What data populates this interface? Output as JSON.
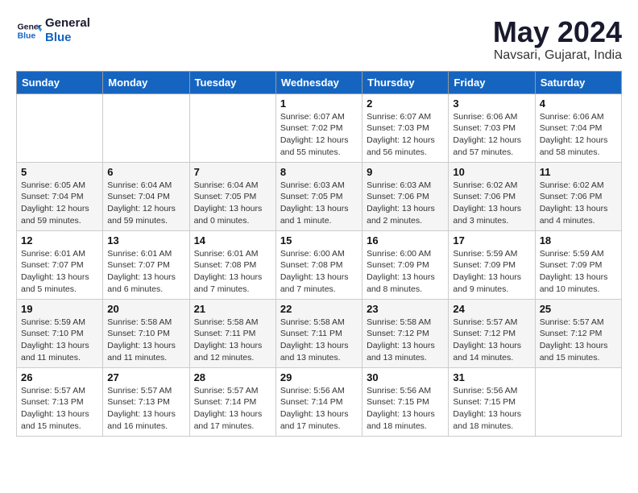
{
  "header": {
    "logo_line1": "General",
    "logo_line2": "Blue",
    "month": "May 2024",
    "location": "Navsari, Gujarat, India"
  },
  "weekdays": [
    "Sunday",
    "Monday",
    "Tuesday",
    "Wednesday",
    "Thursday",
    "Friday",
    "Saturday"
  ],
  "weeks": [
    [
      {
        "day": "",
        "info": ""
      },
      {
        "day": "",
        "info": ""
      },
      {
        "day": "",
        "info": ""
      },
      {
        "day": "1",
        "info": "Sunrise: 6:07 AM\nSunset: 7:02 PM\nDaylight: 12 hours\nand 55 minutes."
      },
      {
        "day": "2",
        "info": "Sunrise: 6:07 AM\nSunset: 7:03 PM\nDaylight: 12 hours\nand 56 minutes."
      },
      {
        "day": "3",
        "info": "Sunrise: 6:06 AM\nSunset: 7:03 PM\nDaylight: 12 hours\nand 57 minutes."
      },
      {
        "day": "4",
        "info": "Sunrise: 6:06 AM\nSunset: 7:04 PM\nDaylight: 12 hours\nand 58 minutes."
      }
    ],
    [
      {
        "day": "5",
        "info": "Sunrise: 6:05 AM\nSunset: 7:04 PM\nDaylight: 12 hours\nand 59 minutes."
      },
      {
        "day": "6",
        "info": "Sunrise: 6:04 AM\nSunset: 7:04 PM\nDaylight: 12 hours\nand 59 minutes."
      },
      {
        "day": "7",
        "info": "Sunrise: 6:04 AM\nSunset: 7:05 PM\nDaylight: 13 hours\nand 0 minutes."
      },
      {
        "day": "8",
        "info": "Sunrise: 6:03 AM\nSunset: 7:05 PM\nDaylight: 13 hours\nand 1 minute."
      },
      {
        "day": "9",
        "info": "Sunrise: 6:03 AM\nSunset: 7:06 PM\nDaylight: 13 hours\nand 2 minutes."
      },
      {
        "day": "10",
        "info": "Sunrise: 6:02 AM\nSunset: 7:06 PM\nDaylight: 13 hours\nand 3 minutes."
      },
      {
        "day": "11",
        "info": "Sunrise: 6:02 AM\nSunset: 7:06 PM\nDaylight: 13 hours\nand 4 minutes."
      }
    ],
    [
      {
        "day": "12",
        "info": "Sunrise: 6:01 AM\nSunset: 7:07 PM\nDaylight: 13 hours\nand 5 minutes."
      },
      {
        "day": "13",
        "info": "Sunrise: 6:01 AM\nSunset: 7:07 PM\nDaylight: 13 hours\nand 6 minutes."
      },
      {
        "day": "14",
        "info": "Sunrise: 6:01 AM\nSunset: 7:08 PM\nDaylight: 13 hours\nand 7 minutes."
      },
      {
        "day": "15",
        "info": "Sunrise: 6:00 AM\nSunset: 7:08 PM\nDaylight: 13 hours\nand 7 minutes."
      },
      {
        "day": "16",
        "info": "Sunrise: 6:00 AM\nSunset: 7:09 PM\nDaylight: 13 hours\nand 8 minutes."
      },
      {
        "day": "17",
        "info": "Sunrise: 5:59 AM\nSunset: 7:09 PM\nDaylight: 13 hours\nand 9 minutes."
      },
      {
        "day": "18",
        "info": "Sunrise: 5:59 AM\nSunset: 7:09 PM\nDaylight: 13 hours\nand 10 minutes."
      }
    ],
    [
      {
        "day": "19",
        "info": "Sunrise: 5:59 AM\nSunset: 7:10 PM\nDaylight: 13 hours\nand 11 minutes."
      },
      {
        "day": "20",
        "info": "Sunrise: 5:58 AM\nSunset: 7:10 PM\nDaylight: 13 hours\nand 11 minutes."
      },
      {
        "day": "21",
        "info": "Sunrise: 5:58 AM\nSunset: 7:11 PM\nDaylight: 13 hours\nand 12 minutes."
      },
      {
        "day": "22",
        "info": "Sunrise: 5:58 AM\nSunset: 7:11 PM\nDaylight: 13 hours\nand 13 minutes."
      },
      {
        "day": "23",
        "info": "Sunrise: 5:58 AM\nSunset: 7:12 PM\nDaylight: 13 hours\nand 13 minutes."
      },
      {
        "day": "24",
        "info": "Sunrise: 5:57 AM\nSunset: 7:12 PM\nDaylight: 13 hours\nand 14 minutes."
      },
      {
        "day": "25",
        "info": "Sunrise: 5:57 AM\nSunset: 7:12 PM\nDaylight: 13 hours\nand 15 minutes."
      }
    ],
    [
      {
        "day": "26",
        "info": "Sunrise: 5:57 AM\nSunset: 7:13 PM\nDaylight: 13 hours\nand 15 minutes."
      },
      {
        "day": "27",
        "info": "Sunrise: 5:57 AM\nSunset: 7:13 PM\nDaylight: 13 hours\nand 16 minutes."
      },
      {
        "day": "28",
        "info": "Sunrise: 5:57 AM\nSunset: 7:14 PM\nDaylight: 13 hours\nand 17 minutes."
      },
      {
        "day": "29",
        "info": "Sunrise: 5:56 AM\nSunset: 7:14 PM\nDaylight: 13 hours\nand 17 minutes."
      },
      {
        "day": "30",
        "info": "Sunrise: 5:56 AM\nSunset: 7:15 PM\nDaylight: 13 hours\nand 18 minutes."
      },
      {
        "day": "31",
        "info": "Sunrise: 5:56 AM\nSunset: 7:15 PM\nDaylight: 13 hours\nand 18 minutes."
      },
      {
        "day": "",
        "info": ""
      }
    ]
  ]
}
